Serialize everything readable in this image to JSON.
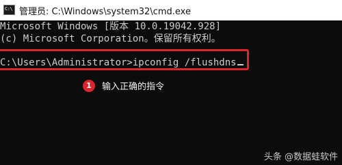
{
  "window": {
    "title": "管理员: C:\\Windows\\system32\\cmd.exe",
    "icon": "cmd-icon",
    "icon_text": "C:\\"
  },
  "console": {
    "lines": [
      "Microsoft Windows [版本 10.0.19042.928]",
      "(c) Microsoft Corporation。保留所有权利。"
    ],
    "prompt": "C:\\Users\\Administrator>",
    "command": "ipconfig /flushdns"
  },
  "annotation": {
    "step_number": "1",
    "label": "输入正确的指令",
    "highlight_color": "#e0242b",
    "badge_color": "#d9262c"
  },
  "watermark": {
    "text": "头条 @数据蛙软件"
  },
  "colors": {
    "console_bg": "#0c0c0c",
    "console_text": "#cccccc",
    "titlebar_bg": "#ffffff"
  }
}
